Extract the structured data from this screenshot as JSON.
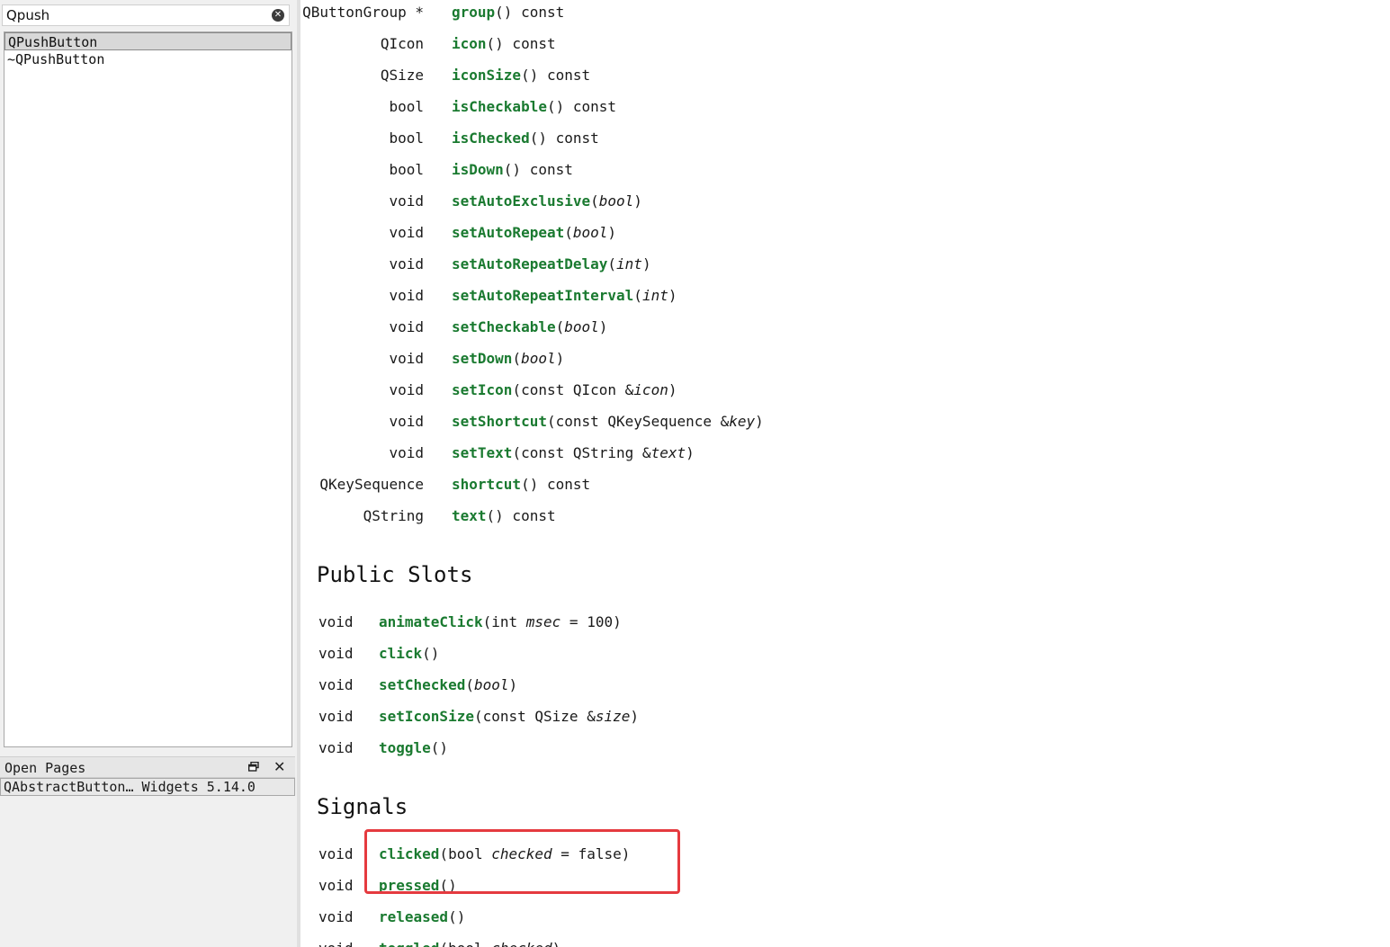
{
  "sidebar": {
    "search": {
      "value": "Qpush",
      "placeholder": ""
    },
    "index_items": [
      {
        "label": "QPushButton",
        "selected": true
      },
      {
        "label": "~QPushButton",
        "selected": false
      }
    ],
    "open_pages": {
      "title": "Open Pages",
      "items": [
        {
          "label": "QAbstractButton… Widgets 5.14.0"
        }
      ]
    }
  },
  "doc": {
    "members": [
      {
        "ret": "QButtonGroup *",
        "name": "group",
        "args": [
          {
            "t": "()"
          },
          {
            "t": " const"
          }
        ]
      },
      {
        "ret": "QIcon",
        "name": "icon",
        "args": [
          {
            "t": "()"
          },
          {
            "t": " const"
          }
        ]
      },
      {
        "ret": "QSize",
        "name": "iconSize",
        "args": [
          {
            "t": "()"
          },
          {
            "t": " const"
          }
        ]
      },
      {
        "ret": "bool",
        "name": "isCheckable",
        "args": [
          {
            "t": "()"
          },
          {
            "t": " const"
          }
        ]
      },
      {
        "ret": "bool",
        "name": "isChecked",
        "args": [
          {
            "t": "()"
          },
          {
            "t": " const"
          }
        ]
      },
      {
        "ret": "bool",
        "name": "isDown",
        "args": [
          {
            "t": "()"
          },
          {
            "t": " const"
          }
        ]
      },
      {
        "ret": "void",
        "name": "setAutoExclusive",
        "args": [
          {
            "t": "("
          },
          {
            "t": "bool",
            "i": true
          },
          {
            "t": ")"
          }
        ]
      },
      {
        "ret": "void",
        "name": "setAutoRepeat",
        "args": [
          {
            "t": "("
          },
          {
            "t": "bool",
            "i": true
          },
          {
            "t": ")"
          }
        ]
      },
      {
        "ret": "void",
        "name": "setAutoRepeatDelay",
        "args": [
          {
            "t": "("
          },
          {
            "t": "int",
            "i": true
          },
          {
            "t": ")"
          }
        ]
      },
      {
        "ret": "void",
        "name": "setAutoRepeatInterval",
        "args": [
          {
            "t": "("
          },
          {
            "t": "int",
            "i": true
          },
          {
            "t": ")"
          }
        ]
      },
      {
        "ret": "void",
        "name": "setCheckable",
        "args": [
          {
            "t": "("
          },
          {
            "t": "bool",
            "i": true
          },
          {
            "t": ")"
          }
        ]
      },
      {
        "ret": "void",
        "name": "setDown",
        "args": [
          {
            "t": "("
          },
          {
            "t": "bool",
            "i": true
          },
          {
            "t": ")"
          }
        ]
      },
      {
        "ret": "void",
        "name": "setIcon",
        "args": [
          {
            "t": "(const QIcon &"
          },
          {
            "t": "icon",
            "i": true
          },
          {
            "t": ")"
          }
        ]
      },
      {
        "ret": "void",
        "name": "setShortcut",
        "args": [
          {
            "t": "(const QKeySequence &"
          },
          {
            "t": "key",
            "i": true
          },
          {
            "t": ")"
          }
        ]
      },
      {
        "ret": "void",
        "name": "setText",
        "args": [
          {
            "t": "(const QString &"
          },
          {
            "t": "text",
            "i": true
          },
          {
            "t": ")"
          }
        ]
      },
      {
        "ret": "QKeySequence",
        "name": "shortcut",
        "args": [
          {
            "t": "()"
          },
          {
            "t": " const"
          }
        ]
      },
      {
        "ret": "QString",
        "name": "text",
        "args": [
          {
            "t": "()"
          },
          {
            "t": " const"
          }
        ]
      }
    ],
    "public_slots": {
      "title": "Public Slots",
      "items": [
        {
          "ret": "void",
          "name": "animateClick",
          "args": [
            {
              "t": "(int "
            },
            {
              "t": "msec",
              "i": true
            },
            {
              "t": " = 100)"
            }
          ]
        },
        {
          "ret": "void",
          "name": "click",
          "args": [
            {
              "t": "()"
            }
          ]
        },
        {
          "ret": "void",
          "name": "setChecked",
          "args": [
            {
              "t": "("
            },
            {
              "t": "bool",
              "i": true
            },
            {
              "t": ")"
            }
          ]
        },
        {
          "ret": "void",
          "name": "setIconSize",
          "args": [
            {
              "t": "(const QSize &"
            },
            {
              "t": "size",
              "i": true
            },
            {
              "t": ")"
            }
          ]
        },
        {
          "ret": "void",
          "name": "toggle",
          "args": [
            {
              "t": "()"
            }
          ]
        }
      ]
    },
    "signals": {
      "title": "Signals",
      "items": [
        {
          "ret": "void",
          "name": "clicked",
          "args": [
            {
              "t": "(bool "
            },
            {
              "t": "checked",
              "i": true
            },
            {
              "t": " = false)"
            }
          ]
        },
        {
          "ret": "void",
          "name": "pressed",
          "args": [
            {
              "t": "()"
            }
          ]
        },
        {
          "ret": "void",
          "name": "released",
          "args": [
            {
              "t": "()"
            }
          ]
        },
        {
          "ret": "void",
          "name": "toggled",
          "args": [
            {
              "t": "(bool "
            },
            {
              "t": "checked",
              "i": true
            },
            {
              "t": ")"
            }
          ]
        }
      ]
    }
  },
  "colors": {
    "function_name": "#1a7a30",
    "highlight_box": "#e53a3f",
    "sidebar_bg": "#f0f0f0"
  }
}
